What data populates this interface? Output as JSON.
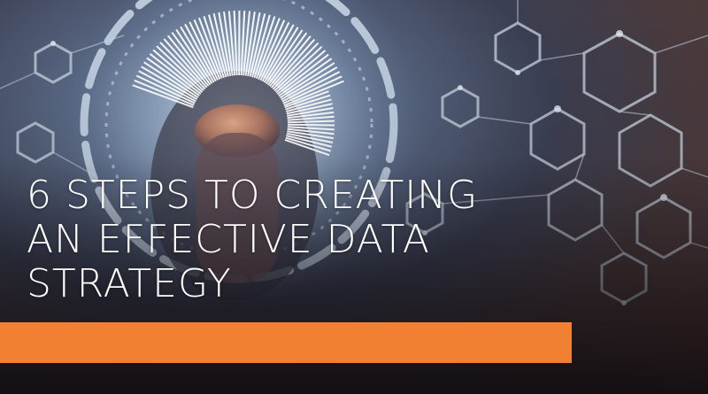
{
  "headline": {
    "line1": "6 STEPS TO CREATING",
    "line2": "AN EFFECTIVE DATA",
    "line3": "STRATEGY"
  },
  "colors": {
    "accent": "#f28033",
    "text": "#ffffff",
    "network_lines": "#c9d4e2"
  },
  "image": {
    "subject": "hand touching a glowing circular dial surrounded by a hexagonal network"
  }
}
